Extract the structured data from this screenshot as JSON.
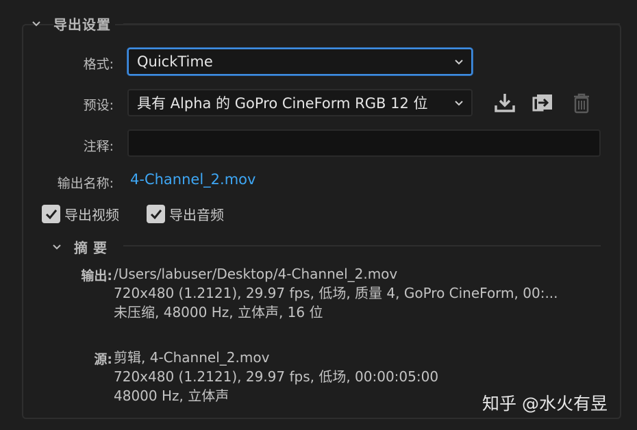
{
  "export_settings": {
    "title": "导出设置",
    "format_label": "格式:",
    "format_value": "QuickTime",
    "preset_label": "预设:",
    "preset_value": "具有 Alpha 的 GoPro CineForm RGB 12 位",
    "comment_label": "注释:",
    "comment_value": "",
    "output_name_label": "输出名称:",
    "output_name_value": "4-Channel_2.mov",
    "export_video_label": "导出视频",
    "export_video_checked": true,
    "export_audio_label": "导出音频",
    "export_audio_checked": true
  },
  "icons": {
    "save_preset": "download-icon",
    "import_preset": "import-icon",
    "delete_preset": "trash-icon"
  },
  "summary": {
    "title": "摘要",
    "output_label": "输出:",
    "output_lines": [
      "/Users/labuser/Desktop/4-Channel_2.mov",
      "720x480 (1.2121), 29.97 fps, 低场, 质量 4, GoPro CineForm, 00:...",
      "未压缩, 48000 Hz, 立体声, 16 位"
    ],
    "source_label": "源:",
    "source_lines": [
      "剪辑, 4-Channel_2.mov",
      "720x480 (1.2121), 29.97 fps, 低场, 00:00:05:00",
      "48000 Hz, 立体声"
    ]
  },
  "watermark": "知乎 @水火有昱",
  "colors": {
    "accent": "#3f8ce0",
    "link": "#3ea7f5",
    "background": "#1e1e1e"
  }
}
